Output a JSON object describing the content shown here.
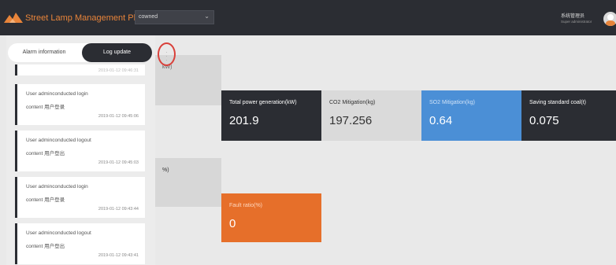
{
  "header": {
    "app_title": "Street Lamp Management Platform",
    "city_value": "cowned",
    "user_name": "系统管理员",
    "user_role": "Super administrator"
  },
  "colors": {
    "header_bg": "#2b2d33",
    "accent_orange": "#e66f2a",
    "stat_blue": "#4b8fd6",
    "more_highlight": "#d9403a"
  },
  "sidebar": {
    "tabs": [
      {
        "label": "Alarm information",
        "active": false
      },
      {
        "label": "Log update",
        "active": true
      }
    ],
    "more_icon": "vertical-ellipsis-icon",
    "top_card_timestamp": "2019-01-12 09:46:31",
    "logs": [
      {
        "line1": "User adminconducted login",
        "line2": "content 用户登录",
        "timestamp": "2019-01-12 09:45:06"
      },
      {
        "line1": "User adminconducted logout",
        "line2": "content 用户登出",
        "timestamp": "2019-01-12 09:45:03"
      },
      {
        "line1": "User adminconducted login",
        "line2": "content 用户登录",
        "timestamp": "2019-01-12 09:43:44"
      },
      {
        "line1": "User adminconducted logout",
        "line2": "content 用户登出",
        "timestamp": "2019-01-12 09:43:41"
      }
    ]
  },
  "stats": {
    "partial_label": "kW)",
    "partial2_label": "%)",
    "total_power": {
      "label": "Total power generation(kW)",
      "value": "201.9"
    },
    "co2": {
      "label": "CO2 Mitigation(kg)",
      "value": "197.256"
    },
    "so2": {
      "label": "SO2 Mitigation(kg)",
      "value": "0.64"
    },
    "coal": {
      "label": "Saving standard coal(t)",
      "value": "0.075"
    },
    "fault": {
      "label": "Fault ratio(%)",
      "value": "0"
    }
  }
}
